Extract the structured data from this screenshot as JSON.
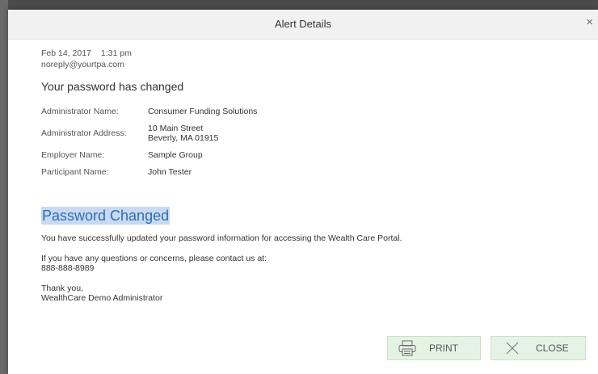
{
  "dialog": {
    "title": "Alert Details",
    "close_glyph": "×"
  },
  "message": {
    "date": "Feb 14, 2017",
    "time": "1:31 pm",
    "from": "noreply@yourtpa.com",
    "subject": "Your password has changed"
  },
  "info": [
    {
      "label": "Administrator Name:",
      "value_line1": "Consumer Funding Solutions",
      "value_line2": ""
    },
    {
      "label": "Administrator Address:",
      "value_line1": "10 Main Street",
      "value_line2": "Beverly, MA 01915"
    },
    {
      "label": "Employer Name:",
      "value_line1": "Sample Group",
      "value_line2": ""
    },
    {
      "label": "Participant Name:",
      "value_line1": "John Tester",
      "value_line2": ""
    }
  ],
  "body": {
    "heading": "Password Changed",
    "paragraph1": "You have successfully updated your password information for accessing the Wealth Care Portal.",
    "paragraph2_line1": "If you have any questions or concerns, please contact us at:",
    "paragraph2_line2": "888-888-8989",
    "paragraph3_line1": "Thank you,",
    "paragraph3_line2": "WealthCare Demo Administrator"
  },
  "buttons": {
    "print_label": "PRINT",
    "close_label": "CLOSE"
  },
  "icons": {
    "print": "printer-icon",
    "close": "x-icon",
    "dialog_close": "close-icon"
  },
  "colors": {
    "heading": "#2f6fb7",
    "heading_highlight": "#c8d9f1",
    "button_bg": "#e5f3e5",
    "button_border": "#c7e2c7"
  }
}
